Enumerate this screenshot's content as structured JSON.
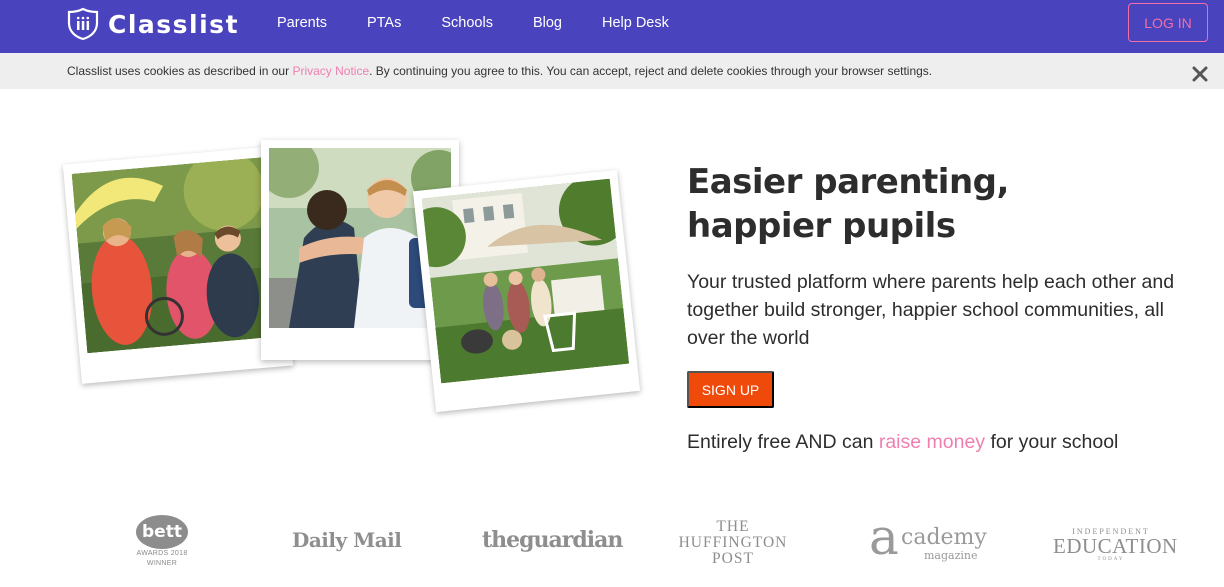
{
  "brand": {
    "name": "Classlist",
    "icon": "shield-logo-icon",
    "nav_color": "#4a43be",
    "accent_pink": "#ef7fb0",
    "cta_orange": "#f04a0b"
  },
  "nav": {
    "links": [
      "Parents",
      "PTAs",
      "Schools",
      "Blog",
      "Help Desk"
    ],
    "login_label": "LOG IN"
  },
  "cookie": {
    "text_before": "Classlist uses cookies as described in our ",
    "link_text": "Privacy Notice",
    "text_after": ". By continuing you agree to this. You can accept, reject and delete cookies through your browser settings.",
    "close_icon": "close-icon"
  },
  "hero": {
    "title_line1": "Easier parenting,",
    "title_line2": "happier pupils",
    "subtitle": "Your trusted platform where parents help each other and together build stronger, happier school communities, all over the world",
    "signup_label": "SIGN UP",
    "free_before": "Entirely free AND can ",
    "free_link": "raise money",
    "free_after": " for your school"
  },
  "press": {
    "bett": {
      "word": "bett",
      "line1": "AWARDS 2018",
      "line2": "WINNER"
    },
    "daily_mail": "Daily Mail",
    "guardian": "theguardian",
    "huffington": [
      "THE",
      "HUFFINGTON",
      "POST"
    ],
    "academy": {
      "letter": "a",
      "word": "cademy",
      "sub": "magazine"
    },
    "independent": {
      "top": "INDEPENDENT",
      "mid": "EDUCATION",
      "bot": "TODAY"
    }
  }
}
